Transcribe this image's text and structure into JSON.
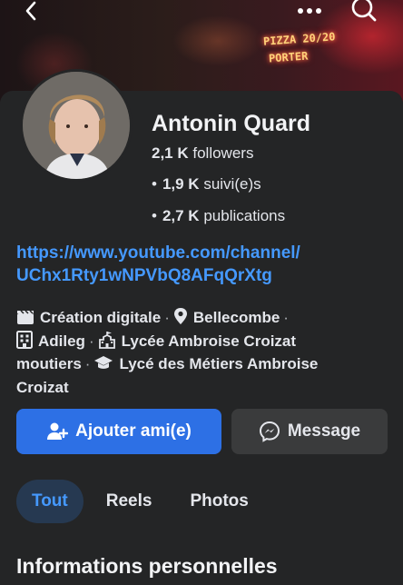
{
  "cover": {
    "neon_line_1": "PIZZA 20/20",
    "neon_line_2": "PORTER"
  },
  "icons": {
    "back": "chevron-left-icon",
    "more": "more-dots-icon",
    "search": "search-icon"
  },
  "profile": {
    "name": "Antonin Quard",
    "followers_count": "2,1 K",
    "followers_label": "followers",
    "following_count": "1,9 K",
    "following_label": "suivi(e)s",
    "posts_count": "2,7 K",
    "posts_label": "publications",
    "link_line_1": "https://www.youtube.com/channel/",
    "link_line_2": "UChx1Rty1wNPVbQ8AFqQrXtg"
  },
  "details": {
    "category": "Création digitale",
    "location": "Bellecombe",
    "workplace": "Adileg",
    "school_1_line_1": "Lycée Ambroise Croizat",
    "school_1_line_2": "moutiers",
    "school_2_line_1": "Lycé des Métiers Ambroise",
    "school_2_line_2": "Croizat",
    "separator": "·"
  },
  "actions": {
    "add_friend": "Ajouter ami(e)",
    "message": "Message"
  },
  "tabs": [
    {
      "label": "Tout"
    },
    {
      "label": "Reels"
    },
    {
      "label": "Photos"
    }
  ],
  "section": {
    "title": "Informations personnelles"
  },
  "colors": {
    "background": "#242526",
    "accent": "#2d70e5",
    "link": "#4599ff",
    "secondary_button": "#3a3b3c",
    "active_tab": "#263951"
  }
}
